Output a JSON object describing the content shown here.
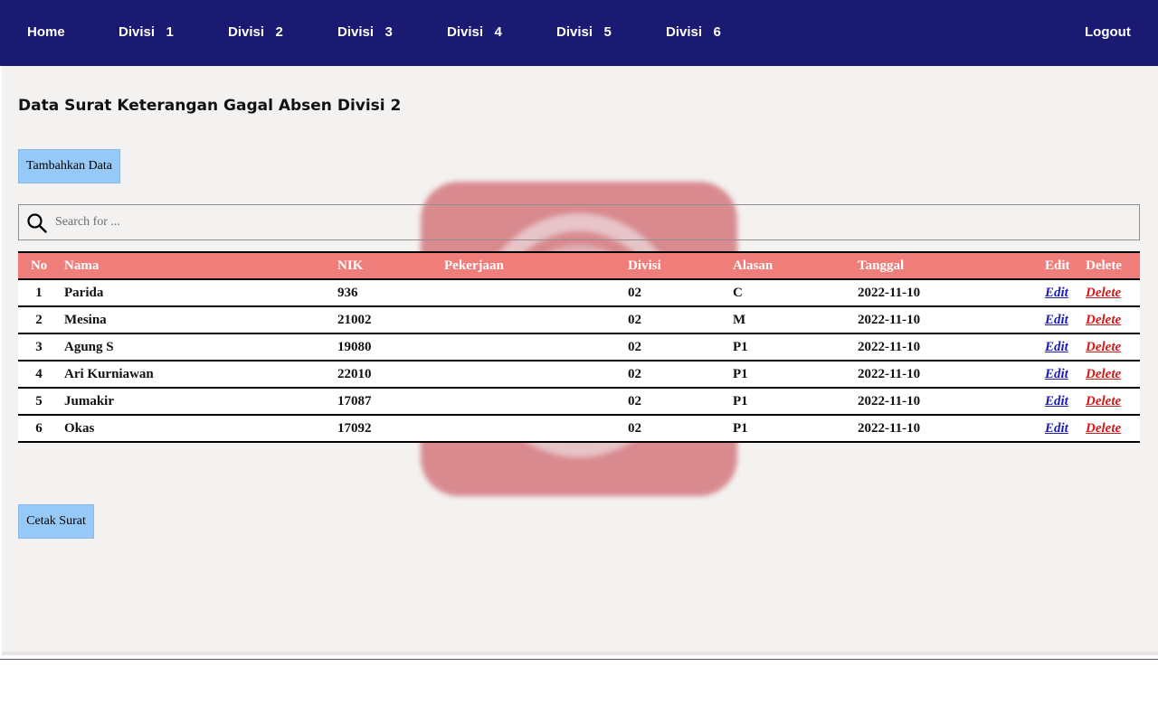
{
  "nav": {
    "home": "Home",
    "divisions": [
      "Divisi   1",
      "Divisi   2",
      "Divisi   3",
      "Divisi   4",
      "Divisi   5",
      "Divisi   6"
    ],
    "logout": "Logout"
  },
  "page": {
    "title": "Data Surat Keterangan Gagal Absen Divisi 2",
    "add_button": "Tambahkan Data",
    "print_button": "Cetak Surat"
  },
  "search": {
    "placeholder": "Search for ...",
    "value": ""
  },
  "table": {
    "headers": {
      "no": "No",
      "nama": "Nama",
      "nik": "NIK",
      "pekerjaan": "Pekerjaan",
      "divisi": "Divisi",
      "alasan": "Alasan",
      "tanggal": "Tanggal",
      "edit": "Edit",
      "delete": "Delete"
    },
    "rows": [
      {
        "no": "1",
        "nama": "Parida",
        "nik": "936",
        "pekerjaan": "",
        "divisi": "02",
        "alasan": "C",
        "tanggal": "2022-11-10",
        "edit": "Edit",
        "delete": "Delete"
      },
      {
        "no": "2",
        "nama": "Mesina",
        "nik": "21002",
        "pekerjaan": "",
        "divisi": "02",
        "alasan": "M",
        "tanggal": "2022-11-10",
        "edit": "Edit",
        "delete": "Delete"
      },
      {
        "no": "3",
        "nama": "Agung S",
        "nik": "19080",
        "pekerjaan": "",
        "divisi": "02",
        "alasan": "P1",
        "tanggal": "2022-11-10",
        "edit": "Edit",
        "delete": "Delete"
      },
      {
        "no": "4",
        "nama": "Ari Kurniawan",
        "nik": "22010",
        "pekerjaan": "",
        "divisi": "02",
        "alasan": "P1",
        "tanggal": "2022-11-10",
        "edit": "Edit",
        "delete": "Delete"
      },
      {
        "no": "5",
        "nama": "Jumakir",
        "nik": "17087",
        "pekerjaan": "",
        "divisi": "02",
        "alasan": "P1",
        "tanggal": "2022-11-10",
        "edit": "Edit",
        "delete": "Delete"
      },
      {
        "no": "6",
        "nama": "Okas",
        "nik": "17092",
        "pekerjaan": "",
        "divisi": "02",
        "alasan": "P1",
        "tanggal": "2022-11-10",
        "edit": "Edit",
        "delete": "Delete"
      }
    ]
  },
  "colors": {
    "navbar": "#1b1a73",
    "table_header": "#ef7e7b",
    "button": "#97c9f7",
    "edit_link": "#1b1bb5",
    "delete_link": "#d11a1a",
    "content_bg": "#f4f2f1"
  },
  "icons": {
    "search": "search-icon",
    "watermark": "logo-watermark"
  }
}
